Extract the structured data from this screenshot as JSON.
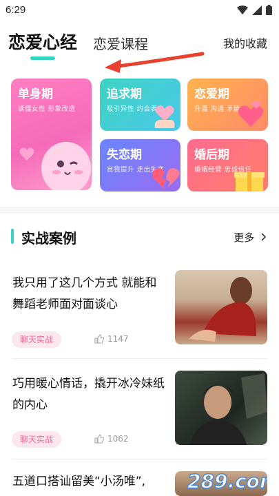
{
  "status": {
    "time": "6:29"
  },
  "tabs": {
    "main": "恋爱心经",
    "course": "恋爱课程",
    "favorites": "我的收藏"
  },
  "categories": [
    {
      "title": "单身期",
      "subtitle": "读懂女性 形象改造"
    },
    {
      "title": "追求期",
      "subtitle": "吸引异性 约会表白"
    },
    {
      "title": "恋爱期",
      "subtitle": "升温 沟通 矛盾"
    },
    {
      "title": "失恋期",
      "subtitle": "自我提升 走出失恋"
    },
    {
      "title": "婚后期",
      "subtitle": "婚姻经营 忠诚信任"
    }
  ],
  "section": {
    "title": "实战案例",
    "more": "更多"
  },
  "articles": [
    {
      "title": "我只用了这几个方式 就能和舞蹈老师面对面谈心",
      "tag": "聊天实战",
      "views": "1147"
    },
    {
      "title": "巧用暖心情话，撬开冰冷妹纸的内心",
      "tag": "聊天实战",
      "views": "1062"
    },
    {
      "title": "五道口搭讪留美“小汤唯”,",
      "tag": "",
      "views": ""
    }
  ],
  "watermark": {
    "text": "289.com"
  },
  "colors": {
    "accent": "#36d3c4",
    "tag_bg": "#fde7ef",
    "tag_text": "#f06a98",
    "arrow": "#e8412f"
  }
}
